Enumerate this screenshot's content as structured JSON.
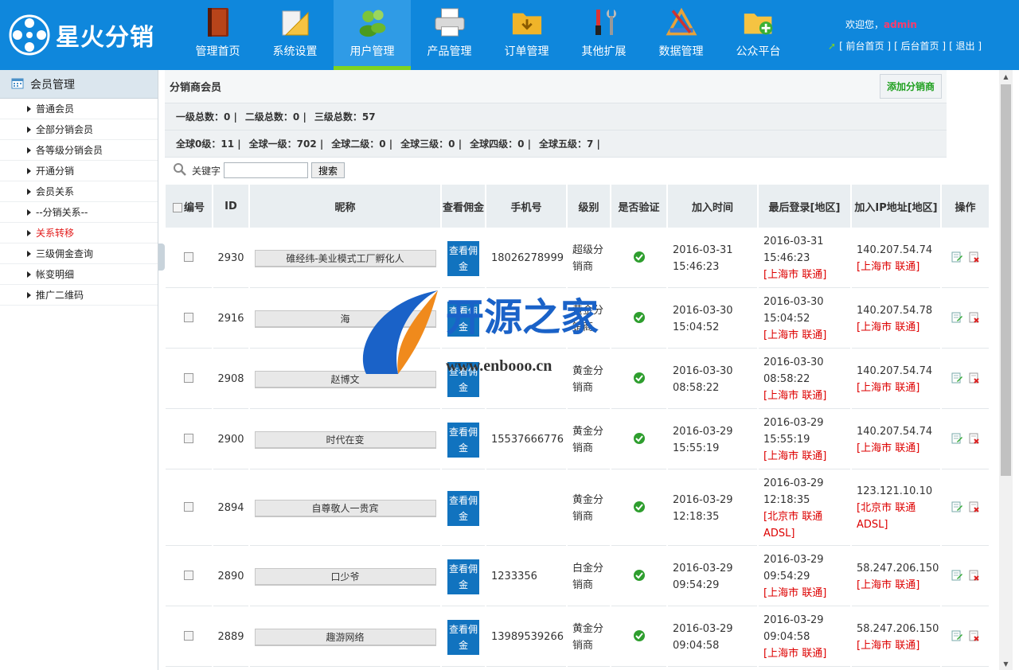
{
  "brand": {
    "name": "星火分销"
  },
  "nav": [
    {
      "label": "管理首页",
      "icon": "book-icon"
    },
    {
      "label": "系统设置",
      "icon": "ruler-icon"
    },
    {
      "label": "用户管理",
      "icon": "users-icon"
    },
    {
      "label": "产品管理",
      "icon": "printer-icon"
    },
    {
      "label": "订单管理",
      "icon": "folder-icon"
    },
    {
      "label": "其他扩展",
      "icon": "tools-icon"
    },
    {
      "label": "数据管理",
      "icon": "pencil-icon"
    },
    {
      "label": "公众平台",
      "icon": "folder-add-icon"
    }
  ],
  "nav_active": 2,
  "user": {
    "welcome": "欢迎您，",
    "name": "admin",
    "links": [
      "[ 前台首页 ]",
      "[ 后台首页 ]",
      "[ 退出 ]"
    ]
  },
  "sidebar": {
    "title": "会员管理",
    "items": [
      {
        "label": "普通会员"
      },
      {
        "label": "全部分销会员"
      },
      {
        "label": "各等级分销会员"
      },
      {
        "label": "开通分销"
      },
      {
        "label": "会员关系"
      },
      {
        "label": "--分销关系--"
      },
      {
        "label": "关系转移",
        "active": true
      },
      {
        "label": "三级佣金查询"
      },
      {
        "label": "帐变明细"
      },
      {
        "label": "推广二维码"
      }
    ]
  },
  "main": {
    "title": "分销商会员",
    "add_button": "添加分销商",
    "stats1": [
      "一级总数：0 |",
      "二级总数：0 |",
      "三级总数：57"
    ],
    "stats2": [
      "全球0级：11 |",
      "全球一级：702 |",
      "全球二级：0 |",
      "全球三级：0 |",
      "全球四级：0 |",
      "全球五级：7 |"
    ],
    "search_label": "关键字",
    "search_button": "搜索"
  },
  "table": {
    "headers": [
      "编号",
      "ID",
      "昵称",
      "查看佣金",
      "手机号",
      "级别",
      "是否验证",
      "加入时间",
      "最后登录[地区]",
      "加入IP地址[地区]",
      "操作"
    ],
    "commission_label": "查看佣金",
    "rows": [
      {
        "id": "2930",
        "nick": "碓经纬-美业模式工厂孵化人",
        "phone": "18026278999",
        "level": "超级分销商",
        "join": "2016-03-31 15:46:23",
        "last": "2016-03-31 15:46:23",
        "last_region": "[上海市 联通]",
        "ip": "140.207.54.74",
        "ip_region": "[上海市 联通]"
      },
      {
        "id": "2916",
        "nick": "海",
        "phone": "",
        "level": "黄金分销商",
        "join": "2016-03-30 15:04:52",
        "last": "2016-03-30 15:04:52",
        "last_region": "[上海市 联通]",
        "ip": "140.207.54.78",
        "ip_region": "[上海市 联通]"
      },
      {
        "id": "2908",
        "nick": "赵博文",
        "phone": "",
        "level": "黄金分销商",
        "join": "2016-03-30 08:58:22",
        "last": "2016-03-30 08:58:22",
        "last_region": "[上海市 联通]",
        "ip": "140.207.54.74",
        "ip_region": "[上海市 联通]"
      },
      {
        "id": "2900",
        "nick": "时代在变",
        "phone": "15537666776",
        "level": "黄金分销商",
        "join": "2016-03-29 15:55:19",
        "last": "2016-03-29 15:55:19",
        "last_region": "[上海市 联通]",
        "ip": "140.207.54.74",
        "ip_region": "[上海市 联通]"
      },
      {
        "id": "2894",
        "nick": "自尊敬人一贵宾",
        "phone": "",
        "level": "黄金分销商",
        "join": "2016-03-29 12:18:35",
        "last": "2016-03-29 12:18:35",
        "last_region": "[北京市 联通 ADSL]",
        "ip": "123.121.10.10",
        "ip_region": "[北京市 联通 ADSL]"
      },
      {
        "id": "2890",
        "nick": "口少爷",
        "phone": "1233356",
        "level": "白金分销商",
        "join": "2016-03-29 09:54:29",
        "last": "2016-03-29 09:54:29",
        "last_region": "[上海市 联通]",
        "ip": "58.247.206.150",
        "ip_region": "[上海市 联通]"
      },
      {
        "id": "2889",
        "nick": "趣游网络",
        "phone": "13989539266",
        "level": "黄金分销商",
        "join": "2016-03-29 09:04:58",
        "last": "2016-03-29 09:04:58",
        "last_region": "[上海市 联通]",
        "ip": "58.247.206.150",
        "ip_region": "[上海市 联通]"
      }
    ]
  },
  "watermark": {
    "title": "开源之家",
    "url": "www.enbooo.cn"
  },
  "colors": {
    "header": "#0f87dc",
    "active_nav": "#2f9be6",
    "accent_green": "#7ed321",
    "commission_btn": "#1173bf",
    "region_red": "#d00000"
  }
}
